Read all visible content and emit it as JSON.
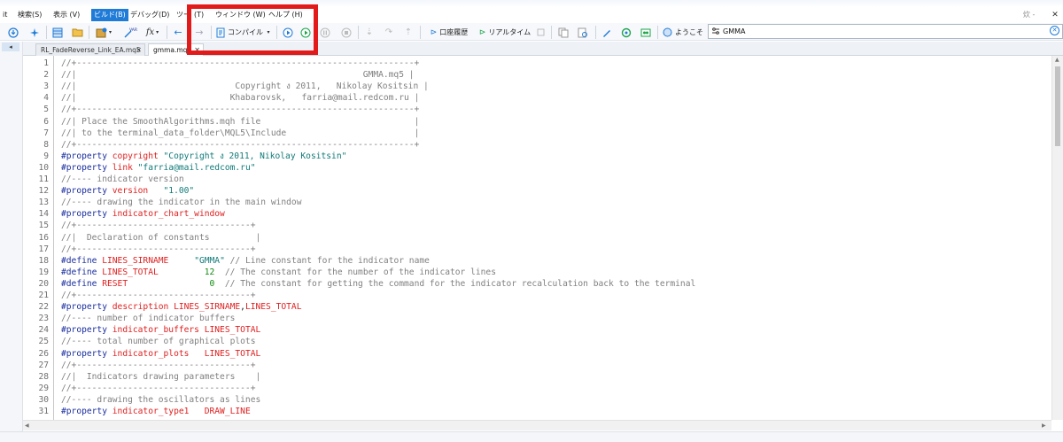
{
  "menu": {
    "items": [
      "it",
      "検索(S)",
      "表示 (V)",
      "ビルド(B)",
      "デバッグ(D)",
      "ツー",
      "(T)",
      "ウィンドウ (W)",
      "ヘルプ (H)"
    ],
    "active_index": 3,
    "top_right_indicator": "炊 -"
  },
  "toolbar": {
    "compile_label": "コンパイル",
    "account_history_label": "口座履歴",
    "realtime_label": "リアルタイム",
    "welcome_label": "ようこそ",
    "var_icon_text": "VAR",
    "fx_label": "fx"
  },
  "search": {
    "value": "GMMA",
    "placeholder": ""
  },
  "tabs": [
    {
      "label": "RL_FadeReverse_Link_EA.mq5",
      "active": false
    },
    {
      "label": "gmma.mq",
      "active": true
    }
  ],
  "editor": {
    "lines": [
      {
        "no": "1",
        "segs": [
          [
            "c",
            "//+------------------------------------------------------------------+"
          ]
        ]
      },
      {
        "no": "2",
        "segs": [
          [
            "c",
            "//|                                                        GMMA.mq5 |"
          ]
        ]
      },
      {
        "no": "3",
        "segs": [
          [
            "c",
            "//|                               Copyright ง 2011,   Nikolay Kositsin |"
          ]
        ]
      },
      {
        "no": "4",
        "segs": [
          [
            "c",
            "//|                              Khabarovsk,   farria@mail.redcom.ru |"
          ]
        ]
      },
      {
        "no": "5",
        "segs": [
          [
            "c",
            "//+------------------------------------------------------------------+"
          ]
        ]
      },
      {
        "no": "6",
        "segs": [
          [
            "c",
            "//| Place the SmoothAlgorithms.mqh file                              |"
          ]
        ]
      },
      {
        "no": "7",
        "segs": [
          [
            "c",
            "//| to the terminal_data_folder\\MQL5\\Include                         |"
          ]
        ]
      },
      {
        "no": "8",
        "segs": [
          [
            "c",
            "//+------------------------------------------------------------------+"
          ]
        ]
      },
      {
        "no": "9",
        "segs": [
          [
            "d",
            "#property "
          ],
          [
            "r",
            "copyright "
          ],
          [
            "s",
            "\"Copyright ง 2011, Nikolay Kositsin\""
          ]
        ]
      },
      {
        "no": "10",
        "segs": [
          [
            "d",
            "#property "
          ],
          [
            "r",
            "link "
          ],
          [
            "s",
            "\"farria@mail.redcom.ru\""
          ]
        ]
      },
      {
        "no": "11",
        "segs": [
          [
            "c",
            "//---- indicator version"
          ]
        ]
      },
      {
        "no": "12",
        "segs": [
          [
            "d",
            "#property "
          ],
          [
            "r",
            "version   "
          ],
          [
            "s",
            "\"1.00\""
          ]
        ]
      },
      {
        "no": "13",
        "segs": [
          [
            "c",
            "//---- drawing the indicator in the main window"
          ]
        ]
      },
      {
        "no": "14",
        "segs": [
          [
            "d",
            "#property "
          ],
          [
            "r",
            "indicator_chart_window"
          ]
        ]
      },
      {
        "no": "15",
        "segs": [
          [
            "c",
            "//+----------------------------------+"
          ]
        ]
      },
      {
        "no": "16",
        "segs": [
          [
            "c",
            "//|  Declaration of constants         |"
          ]
        ]
      },
      {
        "no": "17",
        "segs": [
          [
            "c",
            "//+----------------------------------+"
          ]
        ]
      },
      {
        "no": "18",
        "segs": [
          [
            "d",
            "#define "
          ],
          [
            "r",
            "LINES_SIRNAME"
          ],
          [
            "p",
            "     "
          ],
          [
            "s",
            "\"GMMA\""
          ],
          [
            "c",
            " // Line constant for the indicator name"
          ]
        ]
      },
      {
        "no": "19",
        "segs": [
          [
            "d",
            "#define "
          ],
          [
            "r",
            "LINES_TOTAL"
          ],
          [
            "p",
            "         "
          ],
          [
            "n",
            "12"
          ],
          [
            "c",
            "  // The constant for the number of the indicator lines"
          ]
        ]
      },
      {
        "no": "20",
        "segs": [
          [
            "d",
            "#define "
          ],
          [
            "r",
            "RESET"
          ],
          [
            "p",
            "                "
          ],
          [
            "n",
            "0"
          ],
          [
            "c",
            "  // The constant for getting the command for the indicator recalculation back to the terminal"
          ]
        ]
      },
      {
        "no": "21",
        "segs": [
          [
            "c",
            "//+----------------------------------+"
          ]
        ]
      },
      {
        "no": "22",
        "segs": [
          [
            "d",
            "#property "
          ],
          [
            "r",
            "description LINES_SIRNAME"
          ],
          [
            "p",
            ","
          ],
          [
            "r",
            "LINES_TOTAL"
          ]
        ]
      },
      {
        "no": "23",
        "segs": [
          [
            "c",
            "//---- number of indicator buffers"
          ]
        ]
      },
      {
        "no": "24",
        "segs": [
          [
            "d",
            "#property "
          ],
          [
            "r",
            "indicator_buffers LINES_TOTAL"
          ]
        ]
      },
      {
        "no": "25",
        "segs": [
          [
            "c",
            "//---- total number of graphical plots"
          ]
        ]
      },
      {
        "no": "26",
        "segs": [
          [
            "d",
            "#property "
          ],
          [
            "r",
            "indicator_plots   LINES_TOTAL"
          ]
        ]
      },
      {
        "no": "27",
        "segs": [
          [
            "c",
            "//+----------------------------------+"
          ]
        ]
      },
      {
        "no": "28",
        "segs": [
          [
            "c",
            "//|  Indicators drawing parameters    |"
          ]
        ]
      },
      {
        "no": "29",
        "segs": [
          [
            "c",
            "//+----------------------------------+"
          ]
        ]
      },
      {
        "no": "30",
        "segs": [
          [
            "c",
            "//---- drawing the oscillators as lines"
          ]
        ]
      },
      {
        "no": "31",
        "segs": [
          [
            "d",
            "#property "
          ],
          [
            "r",
            "indicator_type1   DRAW_LINE"
          ]
        ]
      }
    ]
  },
  "colors": {
    "comment": "#808080",
    "directive": "#1a2e9e",
    "keyword": "#e02020",
    "string": "#0f7a78",
    "number": "#0e8a0e",
    "highlight_box": "#e31a1a",
    "accent": "#1f7bd8"
  }
}
